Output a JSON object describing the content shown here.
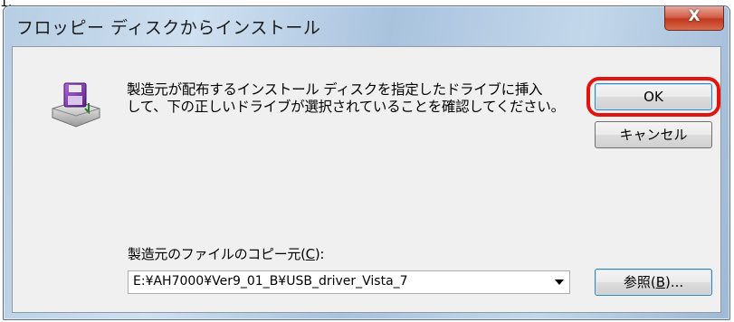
{
  "corner_text": "1.",
  "dialog": {
    "title": "フロッピー ディスクからインストール",
    "close_label": "X",
    "message_line1": "製造元が配布するインストール ディスクを指定したドライブに挿入",
    "message_line2": "して、下の正しいドライブが選択されていることを確認してください。",
    "ok_label": "OK",
    "cancel_label": "キャンセル",
    "copy_from_label_prefix": "製造元のファイルのコピー元(",
    "copy_from_label_key": "C",
    "copy_from_label_suffix": "):",
    "copy_from_value": "E:¥AH7000¥Ver9_01_B¥USB_driver_Vista_7",
    "browse_label_prefix": "参照(",
    "browse_label_key": "B",
    "browse_label_suffix": ")..."
  },
  "colors": {
    "highlight": "#e0150f",
    "close_button": "#c0391f",
    "titlebar": "#b6cde3"
  },
  "icons": {
    "disk": "floppy-disk-install-icon",
    "dropdown": "chevron-down-icon"
  }
}
